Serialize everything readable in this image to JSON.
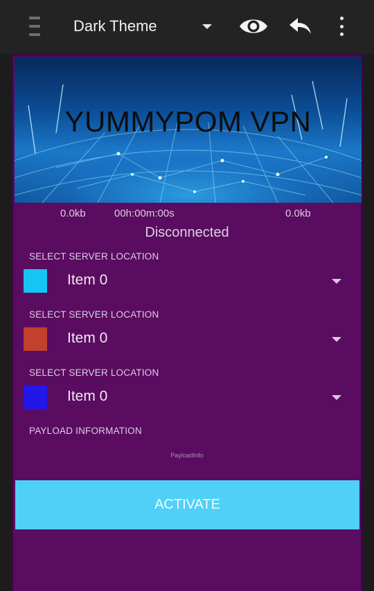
{
  "toolbar": {
    "theme_label": "Dark Theme",
    "icons": [
      "menu-icon",
      "dropdown-caret-icon",
      "eye-icon",
      "reply-icon",
      "more-vert-icon"
    ]
  },
  "banner": {
    "title": "YUMMYPOM VPN"
  },
  "stats": {
    "download": "0.0kb",
    "timer": "00h:00m:00s",
    "upload": "0.0kb"
  },
  "status": "Disconnected",
  "servers": [
    {
      "label": "SELECT SERVER LOCATION",
      "value": "Item 0",
      "color": "#16c6f2"
    },
    {
      "label": "SELECT SERVER LOCATION",
      "value": "Item 0",
      "color": "#c2402c"
    },
    {
      "label": "SELECT SERVER LOCATION",
      "value": "Item 0",
      "color": "#2217e6"
    }
  ],
  "payload": {
    "label": "PAYLOAD INFORMATION",
    "info": "PayloadInfo"
  },
  "activate_label": "ACTIVATE",
  "colors": {
    "panel": "#5a0c61",
    "toolbar": "#232323",
    "button": "#4fd0f7"
  }
}
